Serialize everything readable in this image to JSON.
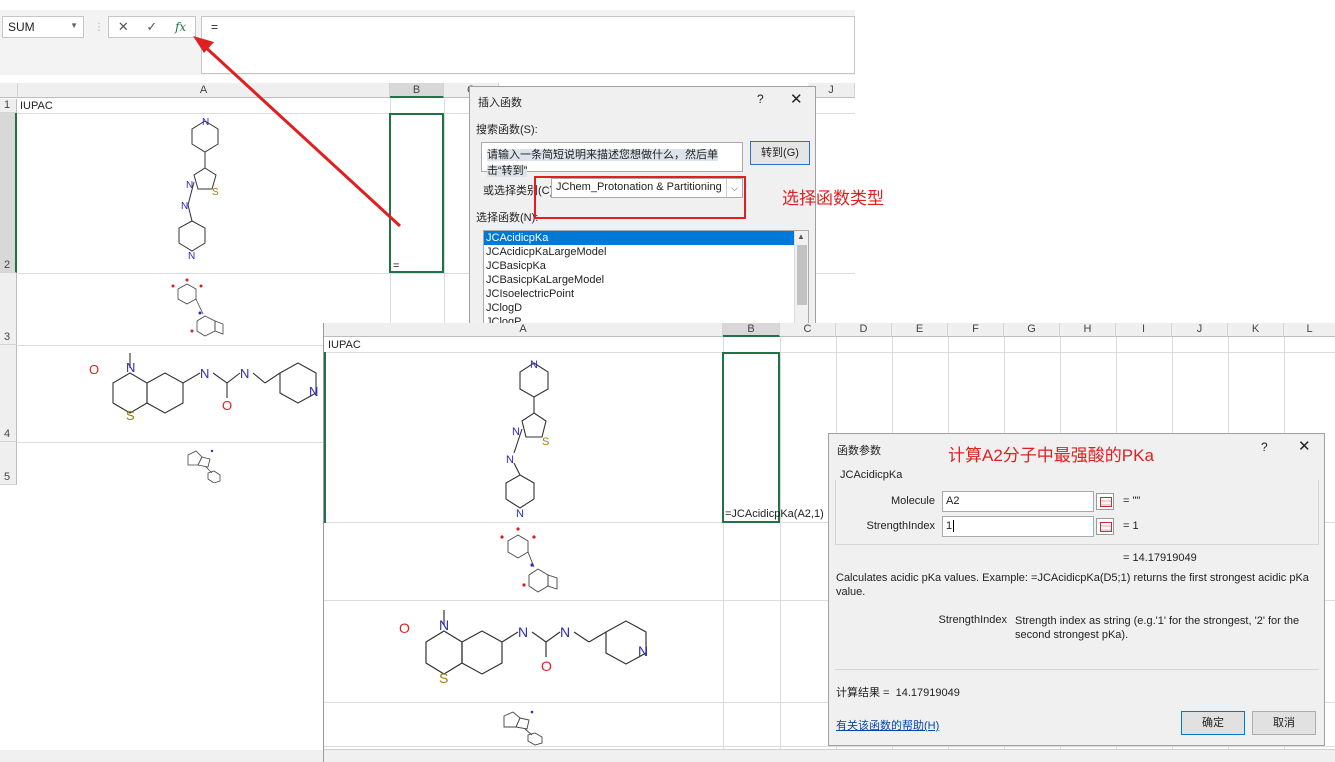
{
  "formula_bar": {
    "name_box": "SUM",
    "cancel_glyph": "✕",
    "enter_glyph": "✓",
    "fx_glyph": "fx",
    "content": "="
  },
  "back_sheet": {
    "columns": [
      "A",
      "B",
      "C",
      "J"
    ],
    "rows": [
      "1",
      "2",
      "3",
      "4",
      "5"
    ],
    "a1": "IUPAC",
    "b2": "="
  },
  "insert_dialog": {
    "title": "插入函数",
    "help": "?",
    "close": "✕",
    "search_label": "搜索函数(S):",
    "search_placeholder": "请输入一条简短说明来描述您想做什么，然后单击“转到”",
    "goto_button": "转到(G)",
    "category_label": "或选择类别(C):",
    "category_value": "JChem_Protonation & Partitioning",
    "function_label": "选择函数(N):",
    "functions": [
      "JCAcidicpKa",
      "JCAcidicpKaLargeModel",
      "JCBasicpKa",
      "JCBasicpKaLargeModel",
      "JCIsoelectricPoint",
      "JClogD",
      "JClogP"
    ],
    "selected_index": 0
  },
  "annotations": {
    "category": "选择函数类型",
    "args": "计算A2分子中最强酸的PKa"
  },
  "front_sheet": {
    "columns": [
      "A",
      "B",
      "C",
      "D",
      "E",
      "F",
      "G",
      "H",
      "I",
      "J",
      "K",
      "L"
    ],
    "a1": "IUPAC",
    "b2": "=JCAcidicpKa(A2,1)"
  },
  "args_dialog": {
    "title": "函数参数",
    "help": "?",
    "close": "✕",
    "function_name": "JCAcidicpKa",
    "args": [
      {
        "label": "Molecule",
        "value": "A2",
        "result": "= \"\""
      },
      {
        "label": "StrengthIndex",
        "value": "1",
        "result": "= 1"
      }
    ],
    "preview": "= 14.17919049",
    "description": "Calculates acidic pKa values. Example: =JCAcidicpKa(D5;1) returns the first strongest acidic pKa value.",
    "param_name": "StrengthIndex",
    "param_desc": "Strength index as string (e.g.'1' for the strongest, '2' for the second strongest pKa).",
    "result_label": "计算结果 =",
    "result_value": "14.17919049",
    "help_link": "有关该函数的帮助(H)",
    "ok": "确定",
    "cancel": "取消"
  },
  "molecule_labels": {
    "n": "N",
    "s": "S",
    "o": "O"
  },
  "colors": {
    "arrow": "#e02020",
    "excel_green": "#217346",
    "selection_blue": "#0078d7"
  }
}
